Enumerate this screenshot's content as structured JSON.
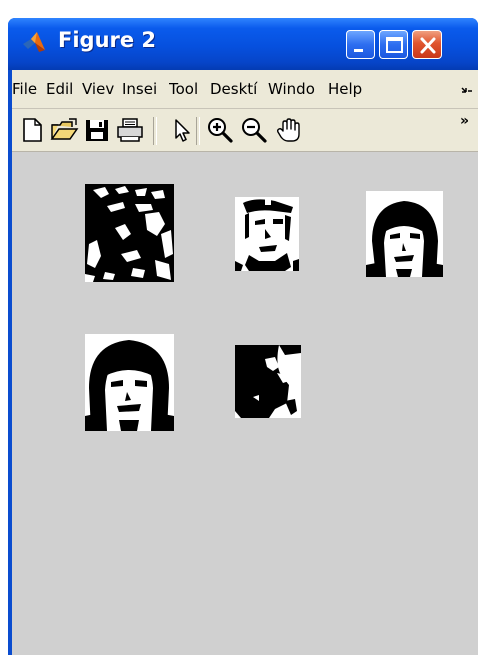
{
  "window": {
    "title": "Figure 2",
    "controls": {
      "minimize": "minimize",
      "maximize": "maximize",
      "close": "close"
    }
  },
  "menubar": {
    "items": [
      "File",
      "Edit",
      "View",
      "Insert",
      "Tools",
      "Desktop",
      "Window",
      "Help"
    ],
    "visible_labels": [
      "File",
      "Edil",
      "Viev",
      "Insei",
      "Tool",
      "Desktí",
      "Windo",
      "Help"
    ],
    "overflow_icon": "menu-overflow-icon"
  },
  "toolbar": {
    "tools": [
      {
        "name": "new-figure",
        "icon": "new-file-icon"
      },
      {
        "name": "open-file",
        "icon": "open-folder-icon"
      },
      {
        "name": "save-figure",
        "icon": "save-disk-icon"
      },
      {
        "name": "print-figure",
        "icon": "printer-icon"
      },
      {
        "name": "edit-plot",
        "icon": "pointer-arrow-icon"
      },
      {
        "name": "zoom-in",
        "icon": "zoom-in-icon"
      },
      {
        "name": "zoom-out",
        "icon": "zoom-out-icon"
      },
      {
        "name": "pan",
        "icon": "hand-pan-icon"
      }
    ],
    "overflow_label": "»"
  },
  "figure": {
    "background": "#d0d0d0",
    "images": [
      {
        "name": "face-image-1",
        "description": "dark thresholded face"
      },
      {
        "name": "face-image-2",
        "description": "face with cap"
      },
      {
        "name": "face-image-3",
        "description": "long-haired face"
      },
      {
        "name": "face-image-4",
        "description": "long-haired face"
      },
      {
        "name": "face-image-5",
        "description": "mostly dark face"
      }
    ]
  },
  "colors": {
    "titlebar_blue": "#0650de",
    "close_red": "#e0552e",
    "menu_bg": "#ece9d8",
    "figure_bg": "#d0d0d0"
  }
}
